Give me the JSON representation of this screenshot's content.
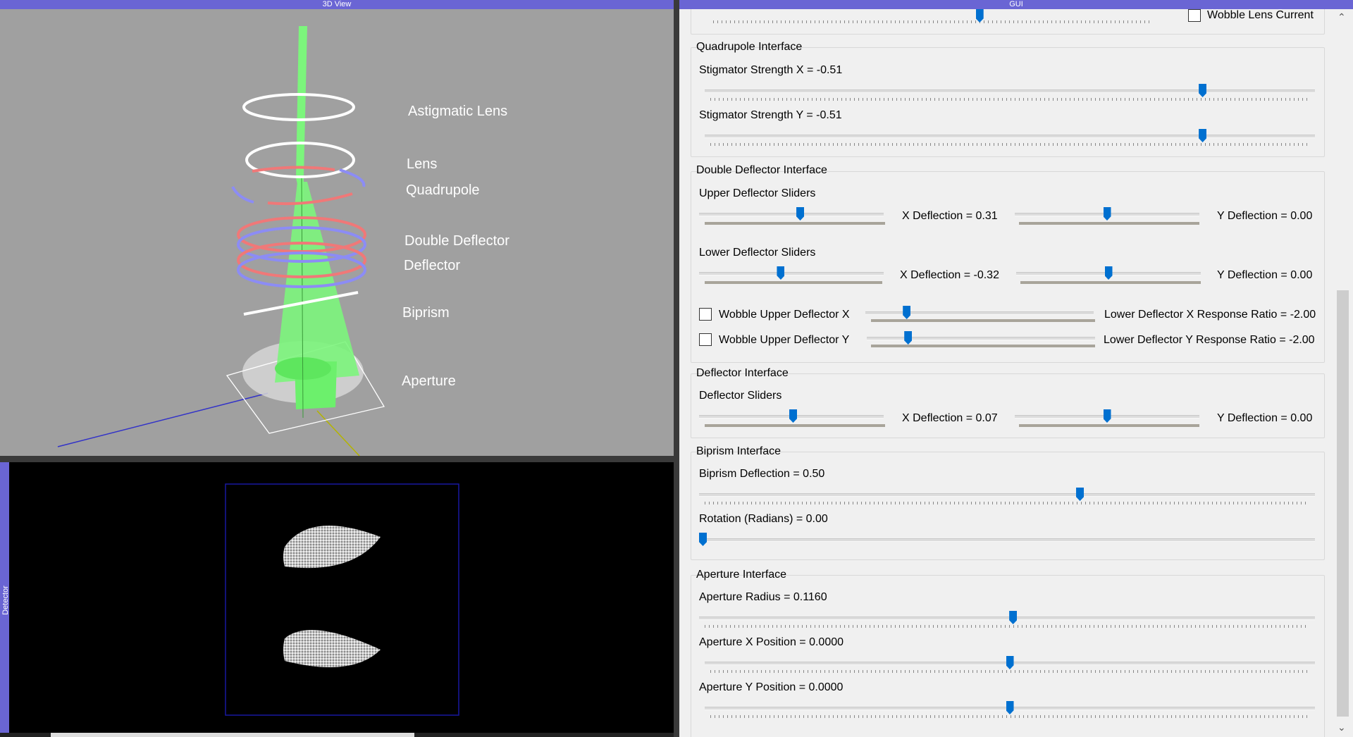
{
  "panes": {
    "view3d_title": "3D View",
    "gui_title": "GUI",
    "detector_title": "Detector"
  },
  "view3d": {
    "labels": {
      "astigmatic_lens": "Astigmatic Lens",
      "lens": "Lens",
      "quadrupole": "Quadrupole",
      "double_deflector": "Double Deflector",
      "deflector": "Deflector",
      "biprism": "Biprism",
      "aperture": "Aperture"
    }
  },
  "gui": {
    "top": {
      "wobble_lens_current": "Wobble Lens Current",
      "wobble_lens_current_checked": false,
      "slider_value": 0.61
    },
    "quadrupole": {
      "title": "Quadrupole Interface",
      "stig_x_label": "Stigmator Strength X = -0.51",
      "stig_x_value": 0.82,
      "stig_y_label": "Stigmator Strength Y = -0.51",
      "stig_y_value": 0.82
    },
    "double_deflector": {
      "title": "Double Deflector Interface",
      "upper_label": "Upper Deflector Sliders",
      "upper_x": "X Deflection = 0.31",
      "upper_y": "Y Deflection = 0.00",
      "upper_x_value": 0.55,
      "upper_y_value": 0.5,
      "lower_label": "Lower Deflector Sliders",
      "lower_x": "X Deflection = -0.32",
      "lower_y": "Y Deflection = 0.00",
      "lower_x_value": 0.44,
      "lower_y_value": 0.5,
      "wobble_x": "Wobble Upper Deflector X",
      "wobble_x_checked": false,
      "wobble_y": "Wobble Upper Deflector Y",
      "wobble_y_checked": false,
      "lower_x_ratio": "Lower Deflector X Response Ratio = -2.00",
      "lower_y_ratio": "Lower Deflector Y Response Ratio = -2.00",
      "ratio_x_value": 0.17,
      "ratio_y_value": 0.17
    },
    "deflector": {
      "title": "Deflector Interface",
      "sliders_label": "Deflector Sliders",
      "x": "X Deflection = 0.07",
      "y": "Y Deflection = 0.00",
      "x_value": 0.51,
      "y_value": 0.5
    },
    "biprism": {
      "title": "Biprism Interface",
      "deflection": "Biprism Deflection = 0.50",
      "deflection_value": 0.62,
      "rotation": "Rotation (Radians) = 0.00",
      "rotation_value": 0.0
    },
    "aperture": {
      "title": "Aperture Interface",
      "radius": "Aperture Radius = 0.1160",
      "radius_value": 0.51,
      "x_pos": "Aperture X Position = 0.0000",
      "x_pos_value": 0.5,
      "y_pos": "Aperture Y Position = 0.0000",
      "y_pos_value": 0.5
    }
  }
}
